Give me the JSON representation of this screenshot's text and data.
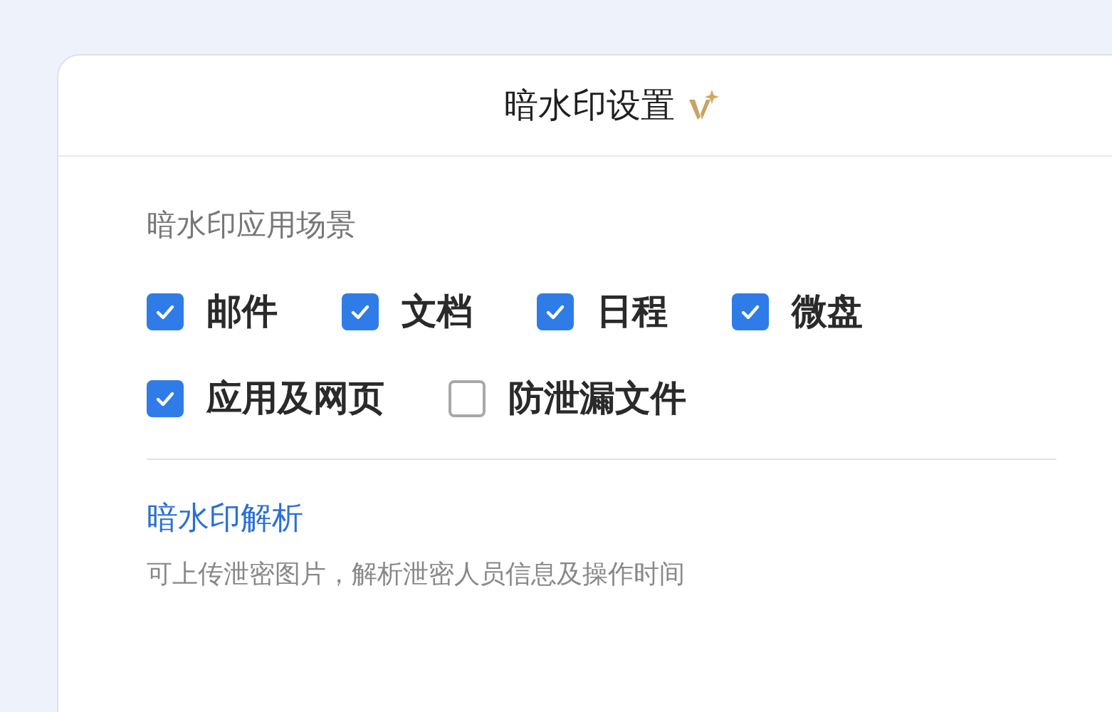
{
  "dialog": {
    "title": "暗水印设置"
  },
  "scenes": {
    "title": "暗水印应用场景",
    "options": [
      {
        "label": "邮件",
        "checked": true
      },
      {
        "label": "文档",
        "checked": true
      },
      {
        "label": "日程",
        "checked": true
      },
      {
        "label": "微盘",
        "checked": true
      },
      {
        "label": "应用及网页",
        "checked": true
      },
      {
        "label": "防泄漏文件",
        "checked": false
      }
    ]
  },
  "analysis": {
    "link": "暗水印解析",
    "description": "可上传泄密图片，解析泄密人员信息及操作时间"
  }
}
